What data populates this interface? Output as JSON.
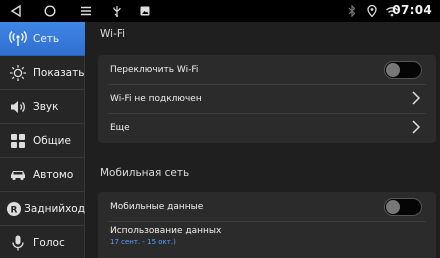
{
  "status_bar": {
    "time": "07:04",
    "icons": [
      "back-icon",
      "home-icon",
      "menu-icon",
      "usb-icon",
      "image-icon",
      "bluetooth-icon",
      "location-icon",
      "wifi-hotspot-icon"
    ]
  },
  "sidebar": {
    "items": [
      {
        "label": "Сеть",
        "icon": "network-icon",
        "active": true
      },
      {
        "label": "Показать",
        "icon": "brightness-icon"
      },
      {
        "label": "Звук",
        "icon": "volume-icon"
      },
      {
        "label": "Общие",
        "icon": "apps-grid-icon"
      },
      {
        "label": "Автомо",
        "icon": "car-icon"
      },
      {
        "label": "Заднийход",
        "icon": "reverse-icon"
      },
      {
        "label": "Голос",
        "icon": "microphone-icon"
      }
    ]
  },
  "wifi": {
    "title": "Wi-Fi",
    "toggle_label": "Переключить Wi-Fi",
    "toggle_on": false,
    "status_label": "Wi-Fi не подключен",
    "more_label": "Еще"
  },
  "mobile": {
    "title": "Мобильная сеть",
    "data_label": "Мобильные данные",
    "data_on": false,
    "usage_label": "Использование данных",
    "usage_period": "17 сент. - 15 окт.)"
  },
  "colors": {
    "accent": "#3a7fe0",
    "background": "#1f1f1f",
    "card": "#2b2b2b",
    "sidebar": "#262626"
  }
}
